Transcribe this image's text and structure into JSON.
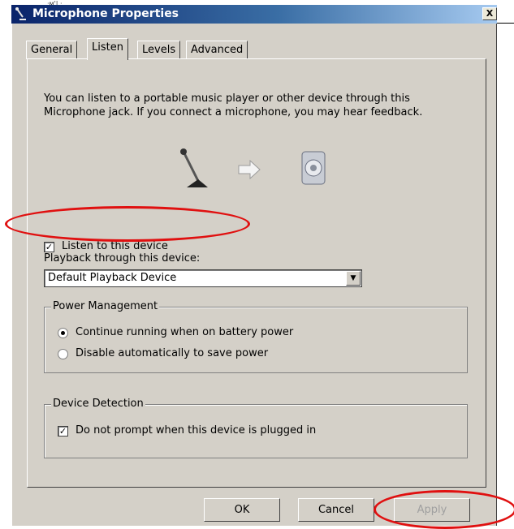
{
  "window": {
    "title": "Microphone Properties",
    "close_label": "X",
    "top_scribble": "·м'| ·"
  },
  "tabs": [
    {
      "label": "General"
    },
    {
      "label": "Listen"
    },
    {
      "label": "Levels"
    },
    {
      "label": "Advanced"
    }
  ],
  "listen": {
    "description": "You can listen to a portable music player or other device through this Microphone jack.  If you connect a microphone, you may hear feedback.",
    "listen_checkbox": {
      "label": "Listen to this device",
      "checked": true
    },
    "playback_label": "Playback through this device:",
    "playback_select": {
      "value": "Default Playback Device"
    }
  },
  "power_management": {
    "title": "Power Management",
    "options": [
      {
        "label": "Continue running when on battery power",
        "selected": true
      },
      {
        "label": "Disable automatically to save power",
        "selected": false
      }
    ]
  },
  "device_detection": {
    "title": "Device Detection",
    "checkbox": {
      "label": "Do not prompt when this device is plugged in",
      "checked": true
    }
  },
  "buttons": {
    "ok": "OK",
    "cancel": "Cancel",
    "apply": "Apply"
  },
  "check_mark": "✓",
  "colors": {
    "annotation": "#e01010",
    "dialog_face": "#d4d0c8",
    "titlebar": "#0a246a"
  }
}
